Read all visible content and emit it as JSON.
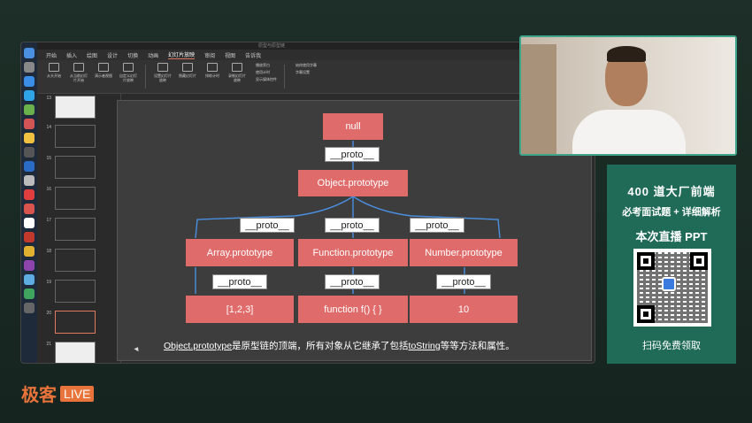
{
  "app": {
    "title": "原型与原型链",
    "tabs": [
      "开始",
      "插入",
      "绘图",
      "设计",
      "切换",
      "动画",
      "幻灯片放映",
      "审阅",
      "视图",
      "告诉我"
    ],
    "active_tab": "幻灯片放映"
  },
  "ribbon": {
    "items": [
      "从头开始",
      "从当前幻灯片开始",
      "演示者视图",
      "自定义幻灯片放映",
      "设置幻灯片放映",
      "隐藏幻灯片",
      "排练计时",
      "录制幻灯片放映"
    ],
    "checks": [
      "播放旁白",
      "使用计时",
      "显示媒体控件"
    ],
    "subtitles": [
      "始终使用字幕",
      "字幕设置"
    ]
  },
  "thumbnails": {
    "numbers": [
      "13",
      "14",
      "15",
      "16",
      "17",
      "18",
      "19",
      "20",
      "21"
    ],
    "selected": "20"
  },
  "diagram": {
    "root": "null",
    "proto_label": "__proto__",
    "object_proto": "Object.prototype",
    "middle": [
      "Array.prototype",
      "Function.prototype",
      "Number.prototype"
    ],
    "leaves": [
      "[1,2,3]",
      "function f() { }",
      "10"
    ],
    "caption_underlined_1": "Object.prototype",
    "caption_mid": "是原型链的顶端，所有对象从它继承了包括",
    "caption_underlined_2": "toString",
    "caption_end": "等等方法和属性。"
  },
  "promo": {
    "line1": "400 道大厂前端",
    "line2": "必考面试题 + 详细解析",
    "line3": "本次直播 PPT",
    "line4": "扫码免费领取"
  },
  "logo": {
    "brand": "极客",
    "live": "LIVE"
  },
  "colors": {
    "box": "#e06b6b",
    "accent_green": "#1f6b57",
    "brand_orange": "#e8743b"
  }
}
